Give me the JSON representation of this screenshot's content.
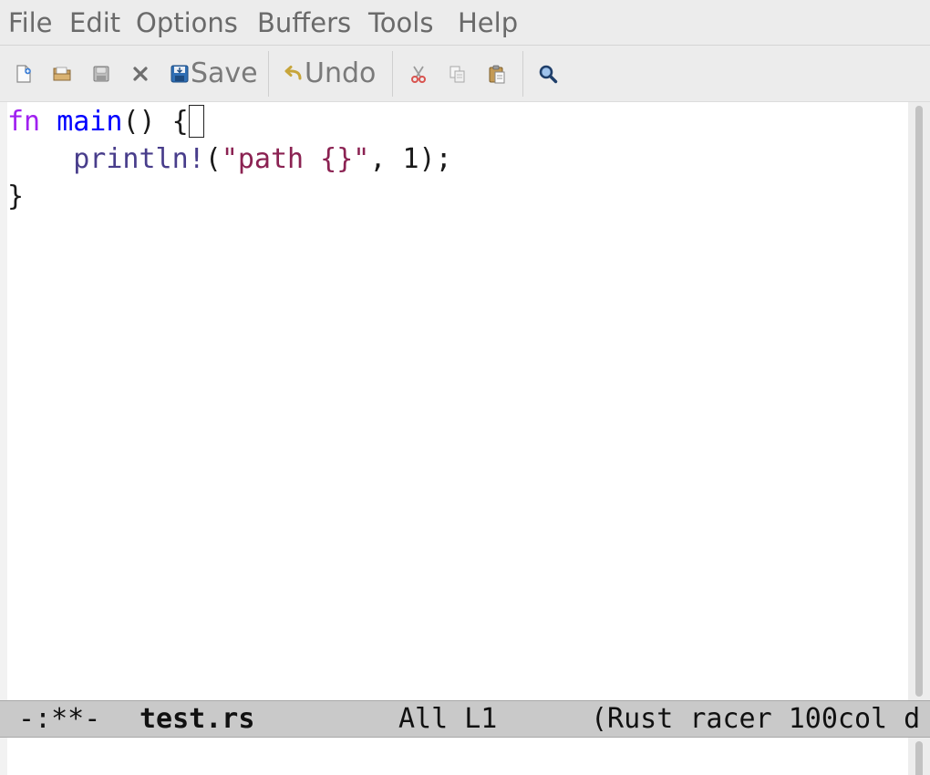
{
  "menu": {
    "items": [
      {
        "label": "File"
      },
      {
        "label": "Edit"
      },
      {
        "label": "Options"
      },
      {
        "label": "Buffers"
      },
      {
        "label": "Tools"
      },
      {
        "label": "Help"
      }
    ]
  },
  "toolbar": {
    "save_label": "Save",
    "undo_label": "Undo"
  },
  "editor": {
    "line1": {
      "kw": "fn",
      "sp1": " ",
      "fn": "main",
      "rest": "() {"
    },
    "line2": {
      "indent": "    ",
      "macro": "println!",
      "open": "(",
      "str": "\"path {}\"",
      "rest": ", 1);"
    },
    "line3": {
      "text": "}"
    }
  },
  "modeline": {
    "status": "-:**-",
    "buffer_name": "test.rs",
    "position": "All L1",
    "modes": "(Rust racer 100col d"
  },
  "colors": {
    "keyword": "#a020f0",
    "function_name": "#0000ff",
    "macro": "#483d8b",
    "string": "#8b2252",
    "menu_bg": "#ececec",
    "modeline_bg": "#c9c9c9"
  }
}
